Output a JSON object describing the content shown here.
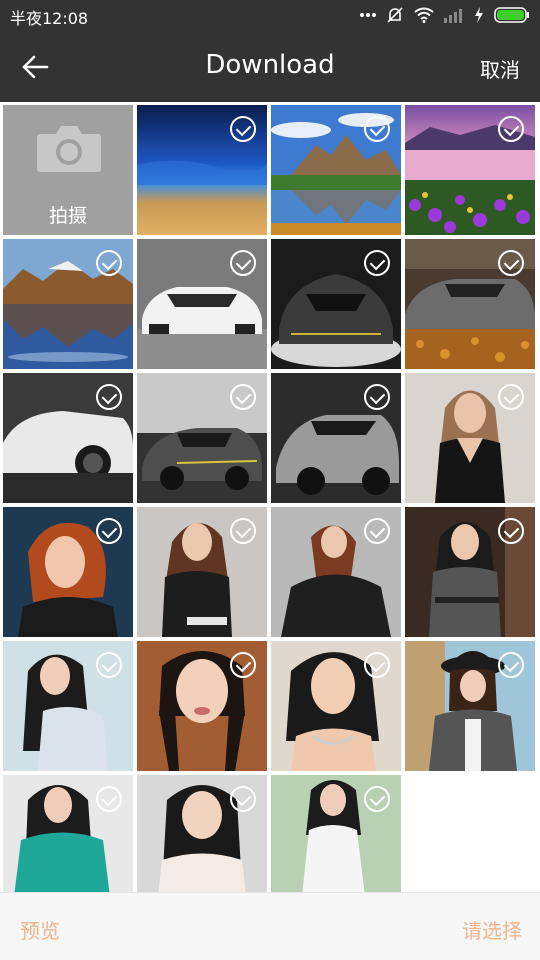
{
  "status_bar": {
    "time": "半夜12:08",
    "icons": [
      "more-dots-icon",
      "do-not-disturb-icon",
      "wifi-icon",
      "signal-icon",
      "charging-icon",
      "battery-icon"
    ],
    "battery_color": "#3ecf2a"
  },
  "toolbar": {
    "title": "Download",
    "cancel_label": "取消",
    "back_icon": "back-arrow-icon"
  },
  "grid": {
    "camera_tile": {
      "label": "拍摄",
      "icon": "camera-icon"
    },
    "photos": [
      {
        "subject": "beach-sunset"
      },
      {
        "subject": "mountain-lake"
      },
      {
        "subject": "pink-lake-flowers"
      },
      {
        "subject": "mountain-reflection"
      },
      {
        "subject": "white-sports-car"
      },
      {
        "subject": "dark-supercar-showroom"
      },
      {
        "subject": "grey-supercar-leaves"
      },
      {
        "subject": "white-supercar"
      },
      {
        "subject": "grey-supercar-road"
      },
      {
        "subject": "silver-supercar"
      },
      {
        "subject": "woman-black-dress"
      },
      {
        "subject": "red-hair-woman"
      },
      {
        "subject": "woman-black-top"
      },
      {
        "subject": "woman-black-suit"
      },
      {
        "subject": "woman-dark-coat"
      },
      {
        "subject": "woman-lace-dress"
      },
      {
        "subject": "woman-braids"
      },
      {
        "subject": "woman-necklace"
      },
      {
        "subject": "woman-hat-plaid"
      },
      {
        "subject": "woman-teal-shirt"
      },
      {
        "subject": "woman-white-top"
      },
      {
        "subject": "woman-white-dress"
      }
    ]
  },
  "bottom_bar": {
    "preview_label": "预览",
    "select_label": "请选择",
    "accent_color": "#f3b38b"
  }
}
